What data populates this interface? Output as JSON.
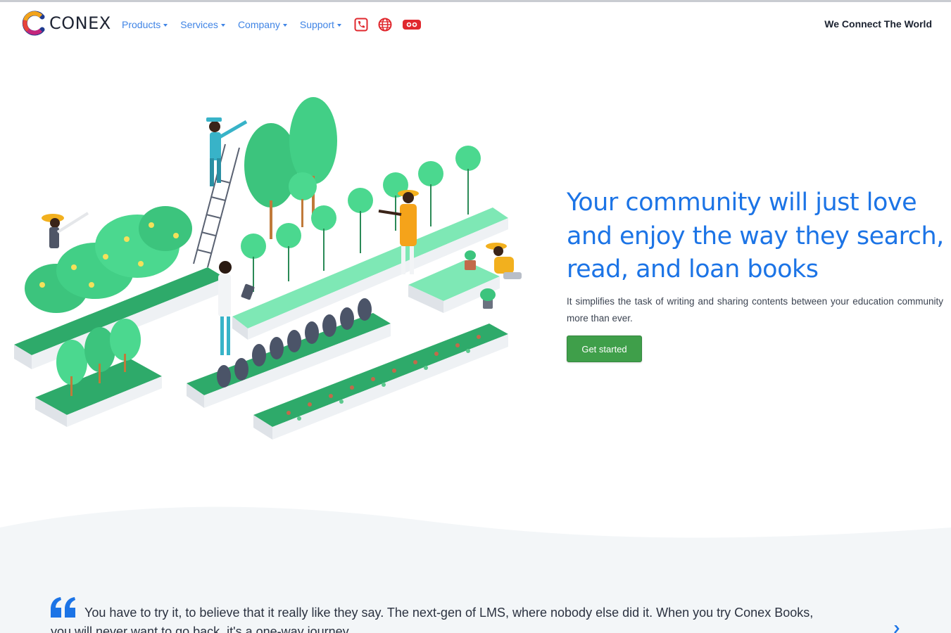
{
  "brand": {
    "name": "Conex",
    "logo_text": "CONEX"
  },
  "nav": {
    "items": [
      {
        "label": "Products"
      },
      {
        "label": "Services"
      },
      {
        "label": "Company"
      },
      {
        "label": "Support"
      }
    ],
    "icons": [
      "phone-icon",
      "globe-icon",
      "video-icon"
    ],
    "tagline": "We Connect The World"
  },
  "hero": {
    "title": "Your community will just love and enjoy the way they search, read, and loan books",
    "subtitle": "It simplifies the task of writing and sharing contents between your education community more than ever.",
    "cta_label": "Get started"
  },
  "testimonial": {
    "line1": "You have to try it, to believe that it really like they say. The next-gen of LMS, where nobody else did it. When you try Conex Books,",
    "line2": "you will never want to go back, it's a one-way journey."
  },
  "colors": {
    "accent": "#1c74e6",
    "nav_link": "#3f84e5",
    "cta": "#3f9f4a",
    "icon_red": "#e0282e",
    "wave": "#f3f6f8"
  }
}
